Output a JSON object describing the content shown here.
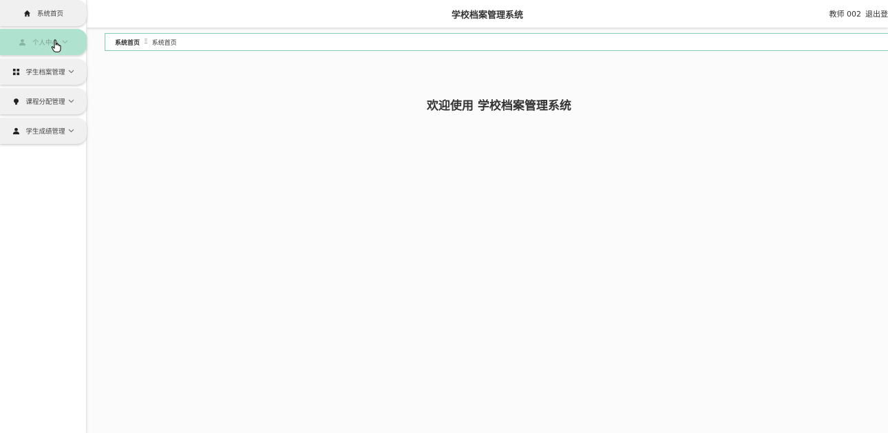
{
  "header": {
    "title": "学校档案管理系统",
    "user": "教师 002",
    "logout": "退出登"
  },
  "sidebar": {
    "items": [
      {
        "label": "系统首页",
        "icon": "home-icon"
      },
      {
        "label": "个人中心",
        "icon": "user-icon",
        "active": true
      },
      {
        "label": "学生档案管理",
        "icon": "grid-icon"
      },
      {
        "label": "课程分配管理",
        "icon": "bulb-icon"
      },
      {
        "label": "学生成绩管理",
        "icon": "user-icon"
      }
    ]
  },
  "breadcrumb": {
    "home": "系统首页",
    "separator": "Ξ",
    "current": "系统首页"
  },
  "main": {
    "welcome": "欢迎使用 学校档案管理系统"
  },
  "colors": {
    "accent": "#b0e2d0",
    "border": "#7fcfb0"
  }
}
